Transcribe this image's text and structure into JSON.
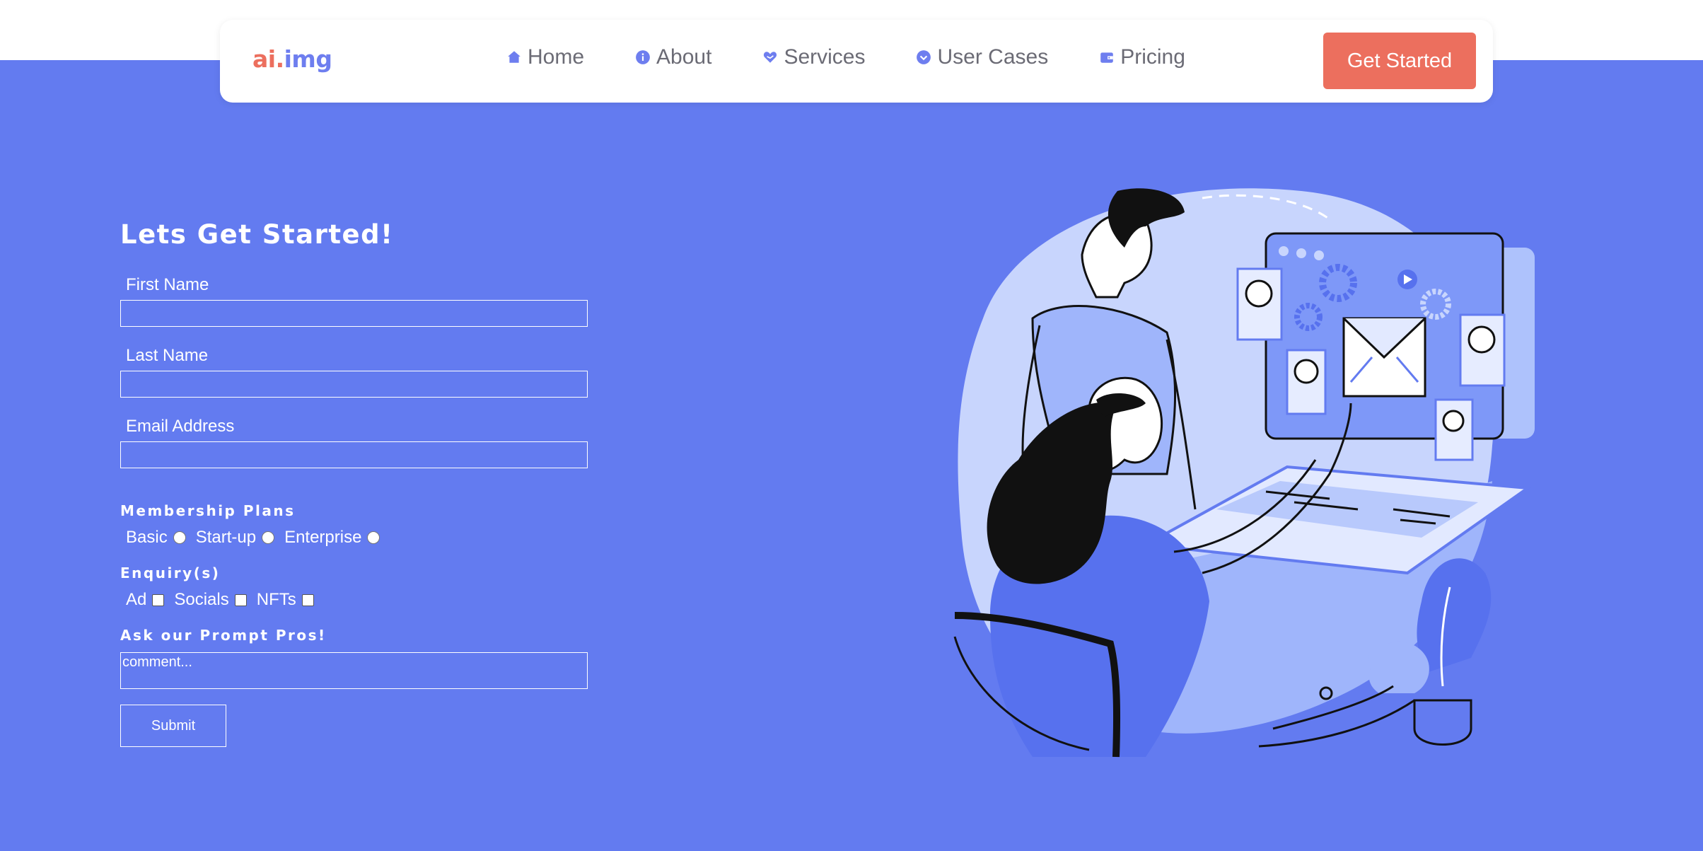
{
  "brand": {
    "logo_part1": "ai.",
    "logo_part2": "img"
  },
  "nav": {
    "items": [
      {
        "label": "Home",
        "icon": "home-icon"
      },
      {
        "label": "About",
        "icon": "info-icon"
      },
      {
        "label": "Services",
        "icon": "heart-hand-icon"
      },
      {
        "label": "User Cases",
        "icon": "chevron-circle-icon"
      },
      {
        "label": "Pricing",
        "icon": "wallet-icon"
      }
    ],
    "cta_label": "Get Started"
  },
  "form": {
    "heading": "Lets Get Started!",
    "first_name_label": "First Name",
    "last_name_label": "Last Name",
    "email_label": "Email Address",
    "membership_label": "Membership Plans",
    "membership_options": [
      "Basic",
      "Start-up",
      "Enterprise"
    ],
    "enquiry_label": "Enquiry(s)",
    "enquiry_options": [
      "Ad",
      "Socials",
      "NFTs"
    ],
    "prompt_label": "Ask our Prompt Pros!",
    "comment_placeholder": "comment...",
    "submit_label": "Submit"
  },
  "colors": {
    "background": "#637BF0",
    "accent": "#EC6F5E",
    "logo_blue": "#6E7EEF"
  }
}
